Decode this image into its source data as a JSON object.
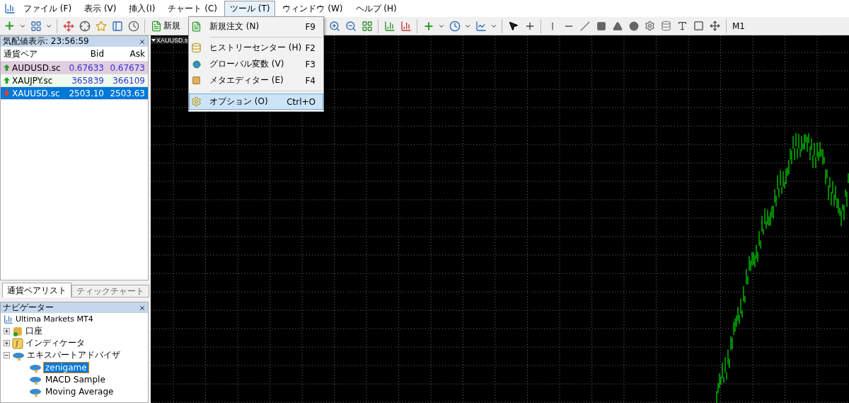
{
  "menu_bar": {
    "items": [
      {
        "label": "ファイル (F)",
        "selected": false
      },
      {
        "label": "表示 (V)",
        "selected": false
      },
      {
        "label": "挿入(I)",
        "selected": false
      },
      {
        "label": "チャート (C)",
        "selected": false
      },
      {
        "label": "ツール (T)",
        "selected": true
      },
      {
        "label": "ウィンドウ (W)",
        "selected": false
      },
      {
        "label": "ヘルプ (H)",
        "selected": false
      }
    ]
  },
  "toolbar": {
    "new_order_label": "新規",
    "timeframe": "M1"
  },
  "tools_menu": {
    "items": [
      {
        "kind": "item",
        "label": "新規注文 (N)",
        "shortcut": "F9",
        "selected": false
      },
      {
        "kind": "separator"
      },
      {
        "kind": "item",
        "label": "ヒストリーセンター (H)",
        "shortcut": "F2",
        "selected": false
      },
      {
        "kind": "item",
        "label": "グローバル変数 (V)",
        "shortcut": "F3",
        "selected": false
      },
      {
        "kind": "item",
        "label": "メタエディター (E)",
        "shortcut": "F4",
        "selected": false
      },
      {
        "kind": "separator"
      },
      {
        "kind": "item",
        "label": "オプション (O)",
        "shortcut": "Ctrl+O",
        "selected": true
      }
    ]
  },
  "market_watch": {
    "title": "気配値表示: 23:56:59",
    "columns": [
      "通貨ペア",
      "Bid",
      "Ask"
    ],
    "rows": [
      {
        "symbol": "AUDUSD.sc",
        "bid": "0.67633",
        "ask": "0.67673",
        "kind": "up",
        "color": "#e2cde0",
        "selected": false
      },
      {
        "symbol": "XAUJPY.sc",
        "bid": "365839",
        "ask": "366109",
        "kind": "up",
        "color": "#eefbee",
        "selected": false
      },
      {
        "symbol": "XAUUSD.sc",
        "bid": "2503.10",
        "ask": "2503.63",
        "kind": "down",
        "color": "#0078d7",
        "selected": true
      }
    ],
    "tabs": [
      {
        "label": "通貨ペアリスト",
        "selected": true
      },
      {
        "label": "ティックチャート",
        "selected": false
      }
    ]
  },
  "navigator": {
    "title": "ナビゲーター",
    "root": "Ultima Markets MT4",
    "items": [
      {
        "label": "口座",
        "kind": "account",
        "expanded": false
      },
      {
        "label": "インディケータ",
        "kind": "indicator",
        "expanded": false
      },
      {
        "label": "エキスパートアドバイザ",
        "kind": "expert",
        "expanded": true,
        "children": [
          {
            "label": "zenigame",
            "selected": true
          },
          {
            "label": "MACD Sample",
            "selected": false
          },
          {
            "label": "Moving Average",
            "selected": false
          }
        ]
      }
    ]
  },
  "chart": {
    "tab": "XAUUSD.s"
  }
}
